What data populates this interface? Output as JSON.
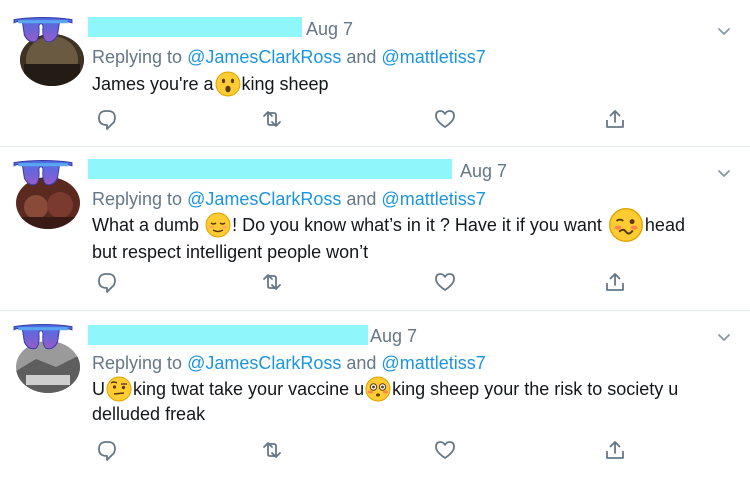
{
  "colors": {
    "accent": "#1b95e0",
    "muted": "#657786",
    "redaction": "#8ff6fb",
    "text": "#14171a"
  },
  "tweets": [
    {
      "date": "Aug 7",
      "reply_prefix": "Replying to ",
      "reply_handle_1": "@JamesClarkRoss",
      "reply_and": " and ",
      "reply_handle_2": "@mattletiss7",
      "line1_a": "James you're a",
      "emoji_1": "astonished-face",
      "line1_b": "king sheep"
    },
    {
      "date": "Aug 7",
      "reply_prefix": "Replying to ",
      "reply_handle_1": "@JamesClarkRoss",
      "reply_and": " and ",
      "reply_handle_2": "@mattletiss7",
      "line1_a": "What a dumb ",
      "emoji_1": "relieved-face",
      "line1_b": "! Do you know what’s in it ? Have it if you want ",
      "emoji_2": "woozy-face",
      "line1_c": "head",
      "line2": "but respect intelligent people won’t"
    },
    {
      "date": "Aug 7",
      "reply_prefix": "Replying to ",
      "reply_handle_1": "@JamesClarkRoss",
      "reply_and": " and ",
      "reply_handle_2": "@mattletiss7",
      "line1_a": "U",
      "emoji_1": "raised-eyebrow-face",
      "line1_b": "king twat take your vaccine u",
      "emoji_2": "flushed-face",
      "line1_c": "king sheep your the risk to society u",
      "line2": "delluded freak"
    }
  ]
}
